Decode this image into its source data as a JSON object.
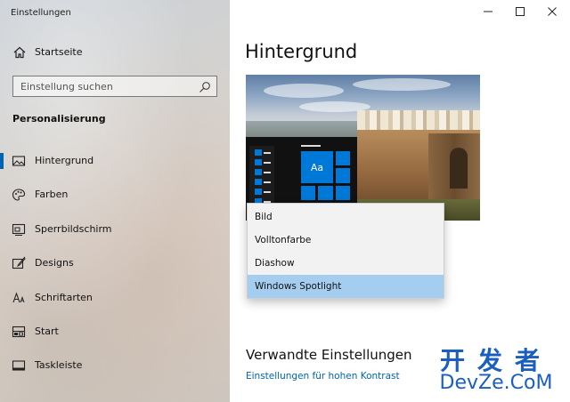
{
  "window": {
    "title": "Einstellungen"
  },
  "sidebar": {
    "home_label": "Startseite",
    "search_placeholder": "Einstellung suchen",
    "section_title": "Personalisierung",
    "items": [
      {
        "label": "Hintergrund",
        "icon": "image-icon",
        "active": true
      },
      {
        "label": "Farben",
        "icon": "palette-icon",
        "active": false
      },
      {
        "label": "Sperrbildschirm",
        "icon": "lock-screen-icon",
        "active": false
      },
      {
        "label": "Designs",
        "icon": "brush-icon",
        "active": false
      },
      {
        "label": "Schriftarten",
        "icon": "font-icon",
        "active": false
      },
      {
        "label": "Start",
        "icon": "start-icon",
        "active": false
      },
      {
        "label": "Taskleiste",
        "icon": "taskbar-icon",
        "active": false
      }
    ]
  },
  "main": {
    "title": "Hintergrund",
    "preview_tile_label": "Aa",
    "dropdown": {
      "options": [
        "Bild",
        "Volltonfarbe",
        "Diashow",
        "Windows Spotlight"
      ],
      "selected": "Windows Spotlight"
    },
    "related_title": "Verwandte Einstellungen",
    "link_high_contrast": "Einstellungen für hohen Kontrast"
  },
  "watermark": {
    "line1": "开发者",
    "line2": "DevZe.CoM"
  },
  "colors": {
    "accent": "#0078d7",
    "link": "#0063b1",
    "selected_option": "#a5cdf0"
  }
}
